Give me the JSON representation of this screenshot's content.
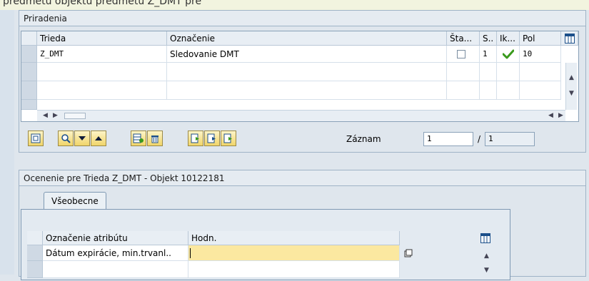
{
  "top_hint": "predmetu objektu predmetu Z_DMT pre",
  "assignments": {
    "title": "Priradenia",
    "columns": [
      "Trieda",
      "Označenie",
      "Šta...",
      "S..",
      "Ik...",
      "Pol"
    ],
    "rows": [
      {
        "trieda": "Z_DMT",
        "oznacenie": "Sledovanie DMT",
        "sta": false,
        "s": "1",
        "ik": "check",
        "pol": "10"
      }
    ]
  },
  "record": {
    "label": "Záznam",
    "value": "1",
    "separator": "/",
    "total": "1"
  },
  "valuation": {
    "title": "Ocenenie pre Trieda Z_DMT - Objekt 10122181",
    "tab": "Všeobecne",
    "columns": [
      "Označenie atribútu",
      "Hodn."
    ],
    "rows": [
      {
        "attr": "Dátum expirácie, min.trvanl..",
        "value": ""
      }
    ]
  },
  "icons": {
    "layout": "table-settings-icon",
    "check": "checkmark-icon",
    "copy": "copy-icon"
  },
  "colors": {
    "accent_yellow": "#f0d56a",
    "highlight": "#fbe8a0",
    "check_green": "#3a9a1d"
  }
}
